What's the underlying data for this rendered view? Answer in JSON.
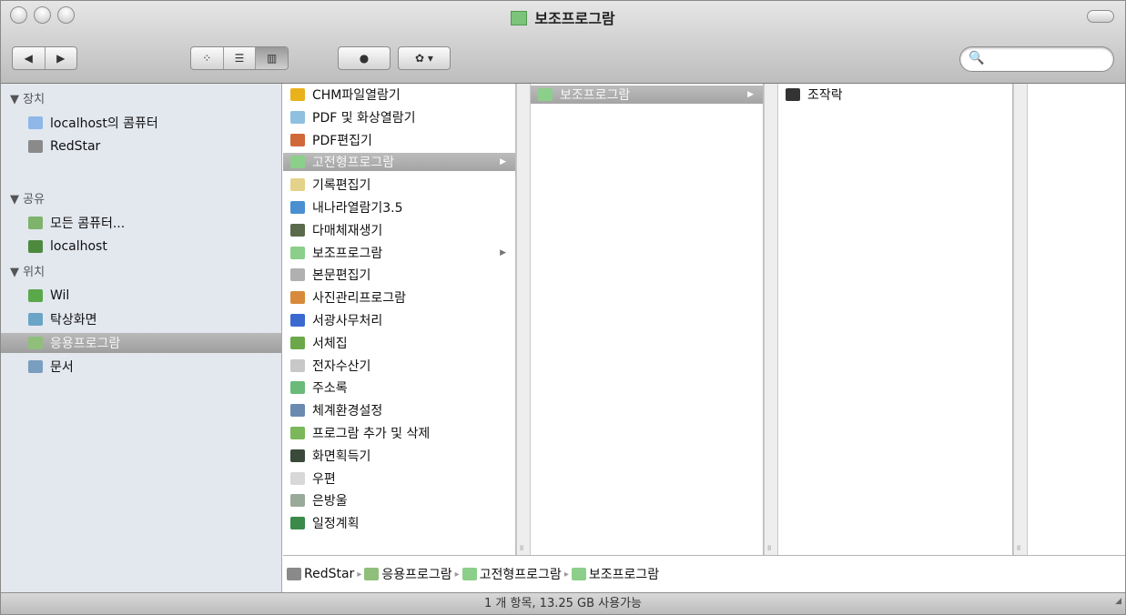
{
  "window": {
    "title": "보조프로그람",
    "status": "1 개 항목, 13.25 GB 사용가능"
  },
  "toolbar": {
    "back_glyph": "◀",
    "forward_glyph": "▶",
    "view_icon_glyph": "⁘",
    "view_list_glyph": "☰",
    "view_column_glyph": "▥",
    "quicklook_glyph": "●",
    "action_glyph": "✿ ▾",
    "search_glyph": "🔍",
    "search_placeholder": ""
  },
  "sidebar": {
    "sections": [
      {
        "label": "▼ 장치",
        "items": [
          {
            "label": "localhost의 콤퓨터",
            "icon": "computer-icon",
            "color": "#8fb7e8"
          },
          {
            "label": "RedStar",
            "icon": "hard-drive-icon",
            "color": "#8a8a8a"
          }
        ]
      },
      {
        "label": "▼ 공유",
        "items": [
          {
            "label": "모든 콤퓨터...",
            "icon": "network-globe-icon",
            "color": "#7db36a"
          },
          {
            "label": "localhost",
            "icon": "monitor-icon",
            "color": "#4e8a3e"
          }
        ]
      },
      {
        "label": "▼ 위치",
        "items": [
          {
            "label": "Wil",
            "icon": "home-icon",
            "color": "#5aa84a"
          },
          {
            "label": "탁상화면",
            "icon": "desktop-folder-icon",
            "color": "#6aa5c8"
          },
          {
            "label": "응용프로그람",
            "icon": "applications-icon",
            "color": "#8fbf7a"
          },
          {
            "label": "문서",
            "icon": "documents-icon",
            "color": "#7a9ec0"
          }
        ]
      }
    ]
  },
  "columns": {
    "col1": [
      {
        "label": "CHM파일열람기",
        "icon": "chm-viewer-icon",
        "color": "#e9b21b"
      },
      {
        "label": "PDF 및 화상열람기",
        "icon": "pdf-viewer-icon",
        "color": "#8fc0e0"
      },
      {
        "label": "PDF편집기",
        "icon": "pdf-editor-icon",
        "color": "#d0683a"
      },
      {
        "label": "고전형프로그람",
        "icon": "folder-icon",
        "color": "#8ccf8a",
        "selected": true,
        "arrow": "▶"
      },
      {
        "label": "기록편집기",
        "icon": "notes-editor-icon",
        "color": "#e4d28a"
      },
      {
        "label": "내나라열람기3.5",
        "icon": "browser-icon",
        "color": "#4a8fd0"
      },
      {
        "label": "다매체재생기",
        "icon": "media-player-icon",
        "color": "#5a6a4a"
      },
      {
        "label": "보조프로그람",
        "icon": "folder-icon",
        "color": "#8ccf8a",
        "arrow": "▶"
      },
      {
        "label": "본문편집기",
        "icon": "text-editor-icon",
        "color": "#b0b0b0"
      },
      {
        "label": "사진관리프로그람",
        "icon": "photo-manager-icon",
        "color": "#d68a3a"
      },
      {
        "label": "서광사무처리",
        "icon": "office-icon",
        "color": "#3a6ad0"
      },
      {
        "label": "서체집",
        "icon": "font-book-icon",
        "color": "#6aa84a"
      },
      {
        "label": "전자수산기",
        "icon": "calculator-icon",
        "color": "#c8c8c8"
      },
      {
        "label": "주소록",
        "icon": "address-book-icon",
        "color": "#6aba7a"
      },
      {
        "label": "체계환경설정",
        "icon": "system-preferences-icon",
        "color": "#6a8ab0"
      },
      {
        "label": "프로그람 추가 및 삭제",
        "icon": "installer-icon",
        "color": "#7ab85a"
      },
      {
        "label": "화면획득기",
        "icon": "screenshot-icon",
        "color": "#3a4a3a"
      },
      {
        "label": "우편",
        "icon": "mail-icon",
        "color": "#d8d8d8"
      },
      {
        "label": "은방울",
        "icon": "bell-icon",
        "color": "#9aaa9a"
      },
      {
        "label": "일정계획",
        "icon": "calendar-icon",
        "color": "#3a8a4a"
      }
    ],
    "col2": [
      {
        "label": "보조프로그람",
        "icon": "folder-icon",
        "color": "#8ccf8a",
        "selected": true,
        "arrow": "▶"
      }
    ],
    "col3": [
      {
        "label": "조작락",
        "icon": "keyboard-icon",
        "color": "#333333"
      }
    ]
  },
  "pathbar": [
    {
      "label": "RedStar",
      "icon": "hard-drive-icon",
      "color": "#8a8a8a"
    },
    {
      "label": "응용프로그람",
      "icon": "applications-icon",
      "color": "#8fbf7a"
    },
    {
      "label": "고전형프로그람",
      "icon": "folder-icon",
      "color": "#8ccf8a"
    },
    {
      "label": "보조프로그람",
      "icon": "folder-icon",
      "color": "#8ccf8a"
    }
  ],
  "pathbar_separator": "▸",
  "column_grip_glyph": "॥",
  "resize_glyph": "◢"
}
